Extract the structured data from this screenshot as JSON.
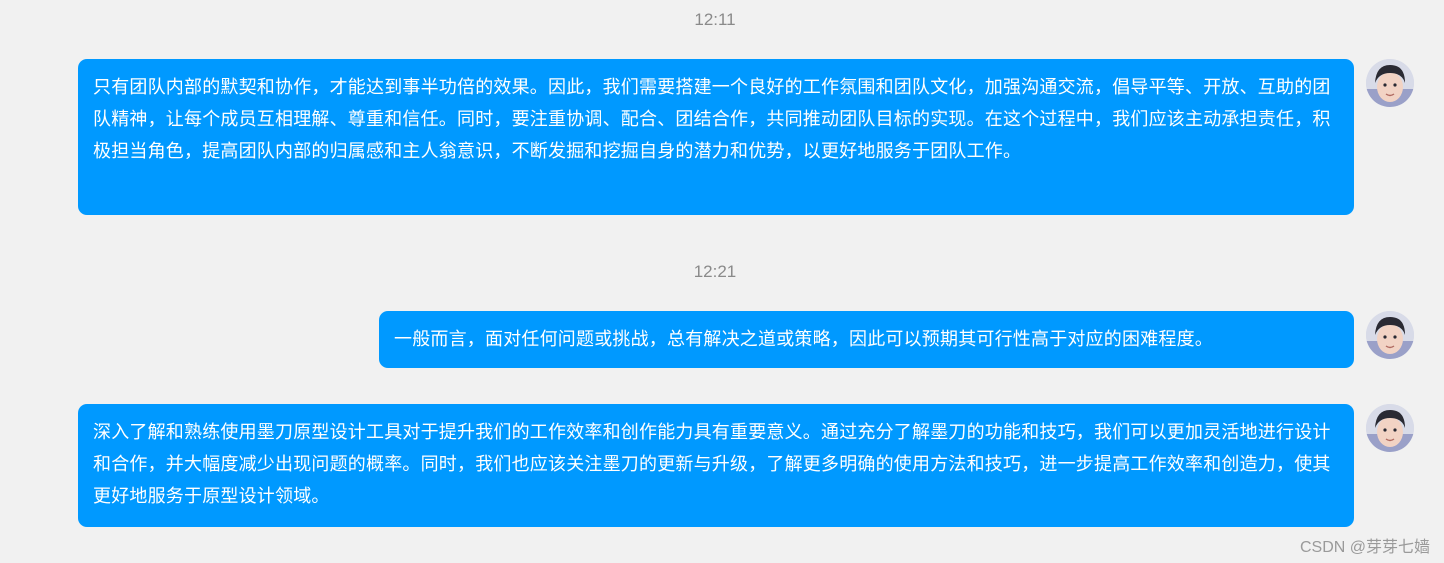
{
  "messages": [
    {
      "timestamp": "12:11",
      "text": "只有团队内部的默契和协作，才能达到事半功倍的效果。因此，我们需要搭建一个良好的工作氛围和团队文化，加强沟通交流，倡导平等、开放、互助的团队精神，让每个成员互相理解、尊重和信任。同时，要注重协调、配合、团结合作，共同推动团队目标的实现。在这个过程中，我们应该主动承担责任，积极担当角色，提高团队内部的归属感和主人翁意识，不断发掘和挖掘自身的潜力和优势，以更好地服务于团队工作。"
    },
    {
      "timestamp": "12:21",
      "text": "一般而言，面对任何问题或挑战，总有解决之道或策略，因此可以预期其可行性高于对应的困难程度。"
    },
    {
      "text": "深入了解和熟练使用墨刀原型设计工具对于提升我们的工作效率和创作能力具有重要意义。通过充分了解墨刀的功能和技巧，我们可以更加灵活地进行设计和合作，并大幅度减少出现问题的概率。同时，我们也应该关注墨刀的更新与升级，了解更多明确的使用方法和技巧，进一步提高工作效率和创造力，使其更好地服务于原型设计领域。"
    }
  ],
  "avatar": {
    "icon": "user-avatar-photo"
  },
  "colors": {
    "bubble": "#0099ff",
    "background": "#f1f1f1",
    "timestamp": "#8a8a8a"
  },
  "watermark": "CSDN @芽芽七嫱"
}
